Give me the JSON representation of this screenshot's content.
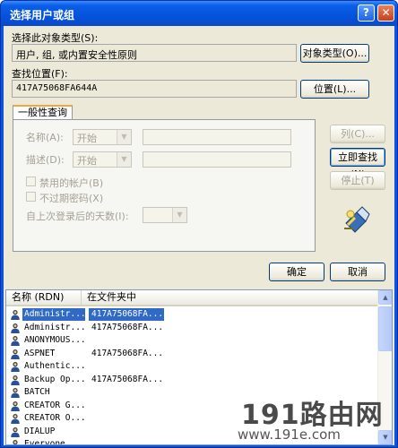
{
  "window": {
    "title": "选择用户或组",
    "help_glyph": "?",
    "close_glyph": "✕"
  },
  "object_type": {
    "label": "选择此对象类型(S):",
    "value": "用户, 组, 或内置安全性原则",
    "button": "对象类型(O)..."
  },
  "location": {
    "label": "查找位置(F):",
    "value": "417A75068FA644A",
    "button": "位置(L)..."
  },
  "query_tab": {
    "label": "一般性查询"
  },
  "query": {
    "name_label": "名称(A):",
    "name_mode": "开始",
    "desc_label": "描述(D):",
    "desc_mode": "开始",
    "disabled_accounts": "禁用的帐户(B)",
    "no_expire_password": "不过期密码(X)",
    "days_since_login": "自上次登录后的天数(I):"
  },
  "side_buttons": {
    "columns": "列(C)...",
    "find_now": "立即查找(N)",
    "stop": "停止(T)"
  },
  "dialog_buttons": {
    "ok": "确定",
    "cancel": "取消"
  },
  "results": {
    "columns": [
      "名称 (RDN)",
      "在文件夹中"
    ],
    "rows": [
      {
        "name": "Administr...",
        "folder": "417A75068FA...",
        "selected": true
      },
      {
        "name": "Administr...",
        "folder": "417A75068FA..."
      },
      {
        "name": "ANONYMOUS...",
        "folder": ""
      },
      {
        "name": "ASPNET",
        "folder": "417A75068FA..."
      },
      {
        "name": "Authentic...",
        "folder": ""
      },
      {
        "name": "Backup Op...",
        "folder": "417A75068FA..."
      },
      {
        "name": "BATCH",
        "folder": ""
      },
      {
        "name": "CREATOR G...",
        "folder": ""
      },
      {
        "name": "CREATOR O...",
        "folder": ""
      },
      {
        "name": "DIALUP",
        "folder": ""
      },
      {
        "name": "Everyone",
        "folder": ""
      }
    ]
  },
  "watermark": {
    "main": "191路由网",
    "sub": "www.191e.com"
  },
  "icons": {
    "search": "magnifier-flashlight-icon",
    "user": "user-icon",
    "scroll_up": "▲",
    "scroll_down": "▼",
    "combo": "▼"
  }
}
